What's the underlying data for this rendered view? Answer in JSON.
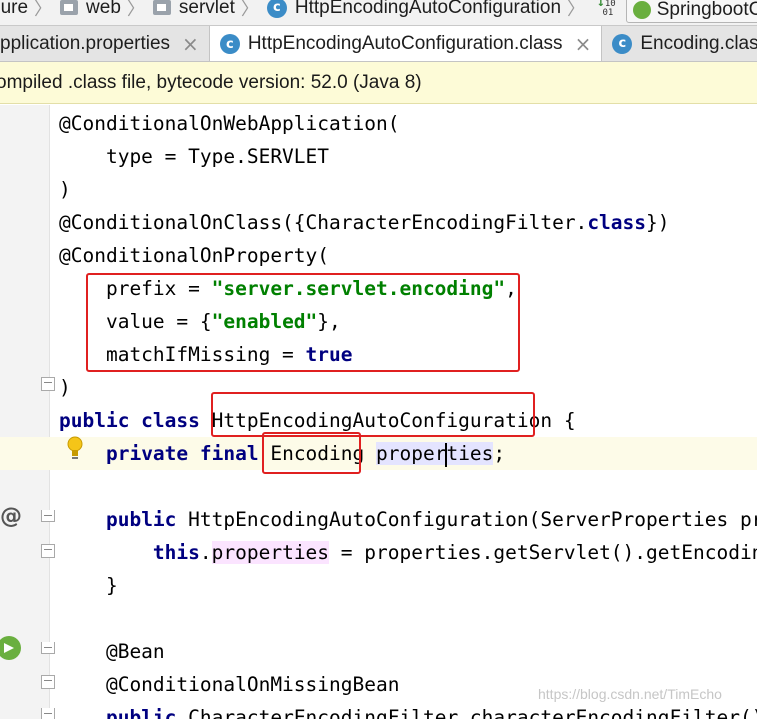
{
  "breadcrumb": {
    "items": [
      "gure",
      "web",
      "servlet",
      "HttpEncodingAutoConfiguration"
    ],
    "run_config": "SpringbootC"
  },
  "tabs": [
    {
      "label": "pplication.properties"
    },
    {
      "label": "HttpEncodingAutoConfiguration.class"
    },
    {
      "label": "Encoding.clas"
    }
  ],
  "tab_close_glyph": "×",
  "banner": {
    "text": "ompiled .class file, bytecode version: 52.0 (Java 8)"
  },
  "code": {
    "l1": "@ConditionalOnWebApplication(",
    "l2": "    type = Type.SERVLET",
    "l3": ")",
    "l4a": "@ConditionalOnClass({CharacterEncodingFilter.",
    "l4b": "class",
    "l4c": "})",
    "l5": "@ConditionalOnProperty(",
    "l6a": "    prefix = ",
    "l6b": "\"server.servlet.encoding\"",
    "l6c": ",",
    "l7a": "    value = {",
    "l7b": "\"enabled\"",
    "l7c": "},",
    "l8a": "    matchIfMissing = ",
    "l8b": "true",
    "l9": ")",
    "l10a": "public class",
    "l10b": " HttpEncodingAutoConfiguration {",
    "l11a": "    ",
    "l11b": "private final",
    "l11c": " Encoding ",
    "l11d": "proper",
    "l11e": "ties",
    "l11f": ";",
    "l13a": "    ",
    "l13b": "public",
    "l13c": " HttpEncodingAutoConfiguration(ServerProperties prope",
    "l14a": "        ",
    "l14b": "this",
    "l14c": ".",
    "l14d": "properties",
    "l14e": " = properties.getServlet().getEncoding()",
    "l15": "    }",
    "l17": "    @Bean",
    "l18": "    @ConditionalOnMissingBean",
    "l19a": "    ",
    "l19b": "public",
    "l19c": " CharacterEncodingFilter characterEncodingFilter() {"
  },
  "gutter": {
    "override_marker": "@"
  },
  "watermark": "https://blog.csdn.net/TimEcho",
  "colors": {
    "keyword": "#000080",
    "string": "#008000",
    "annotation_box": "#e02020"
  }
}
